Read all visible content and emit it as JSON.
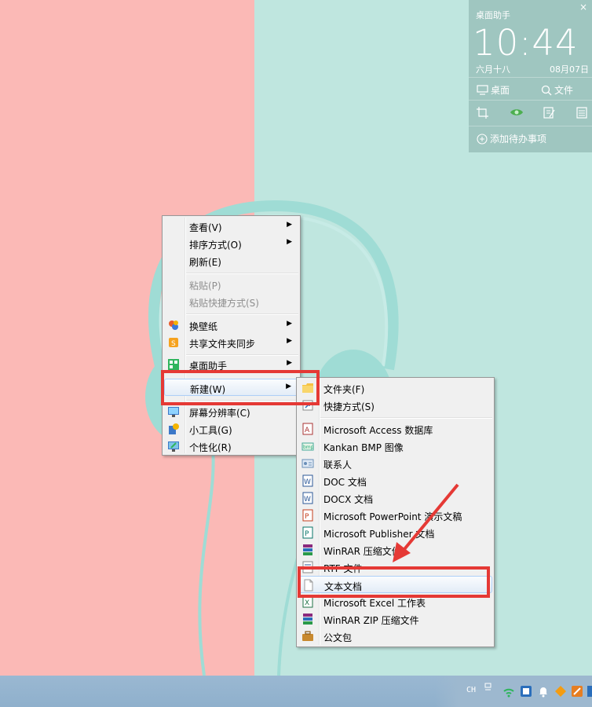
{
  "widget": {
    "title": "桌面助手",
    "close": "×",
    "time": "10:44",
    "lunar": "六月十八",
    "date": "08月07日",
    "desktop_label": "桌面",
    "files_label": "文件",
    "add_todo": "添加待办事项"
  },
  "context_menu": {
    "items": [
      {
        "label": "查看(V)"
      },
      {
        "label": "排序方式(O)"
      },
      {
        "label": "刷新(E)"
      },
      {
        "label": "粘贴(P)"
      },
      {
        "label": "粘贴快捷方式(S)"
      },
      {
        "label": "换壁纸"
      },
      {
        "label": "共享文件夹同步"
      },
      {
        "label": "桌面助手"
      },
      {
        "label": "新建(W)"
      },
      {
        "label": "屏幕分辨率(C)"
      },
      {
        "label": "小工具(G)"
      },
      {
        "label": "个性化(R)"
      }
    ]
  },
  "new_submenu": {
    "items": [
      {
        "label": "文件夹(F)"
      },
      {
        "label": "快捷方式(S)"
      },
      {
        "label": "Microsoft Access 数据库"
      },
      {
        "label": "Kankan BMP 图像"
      },
      {
        "label": "联系人"
      },
      {
        "label": "DOC 文档"
      },
      {
        "label": "DOCX 文档"
      },
      {
        "label": "Microsoft PowerPoint 演示文稿"
      },
      {
        "label": "Microsoft Publisher 文档"
      },
      {
        "label": "WinRAR 压缩文件"
      },
      {
        "label": "RTF 文件"
      },
      {
        "label": "文本文档"
      },
      {
        "label": "Microsoft Excel 工作表"
      },
      {
        "label": "WinRAR ZIP 压缩文件"
      },
      {
        "label": "公文包"
      }
    ]
  },
  "taskbar": {
    "lang": "CH"
  },
  "colors": {
    "wall_left": "#fbb9b6",
    "wall_right": "#bfe6df",
    "highlight_box": "#e53935"
  }
}
